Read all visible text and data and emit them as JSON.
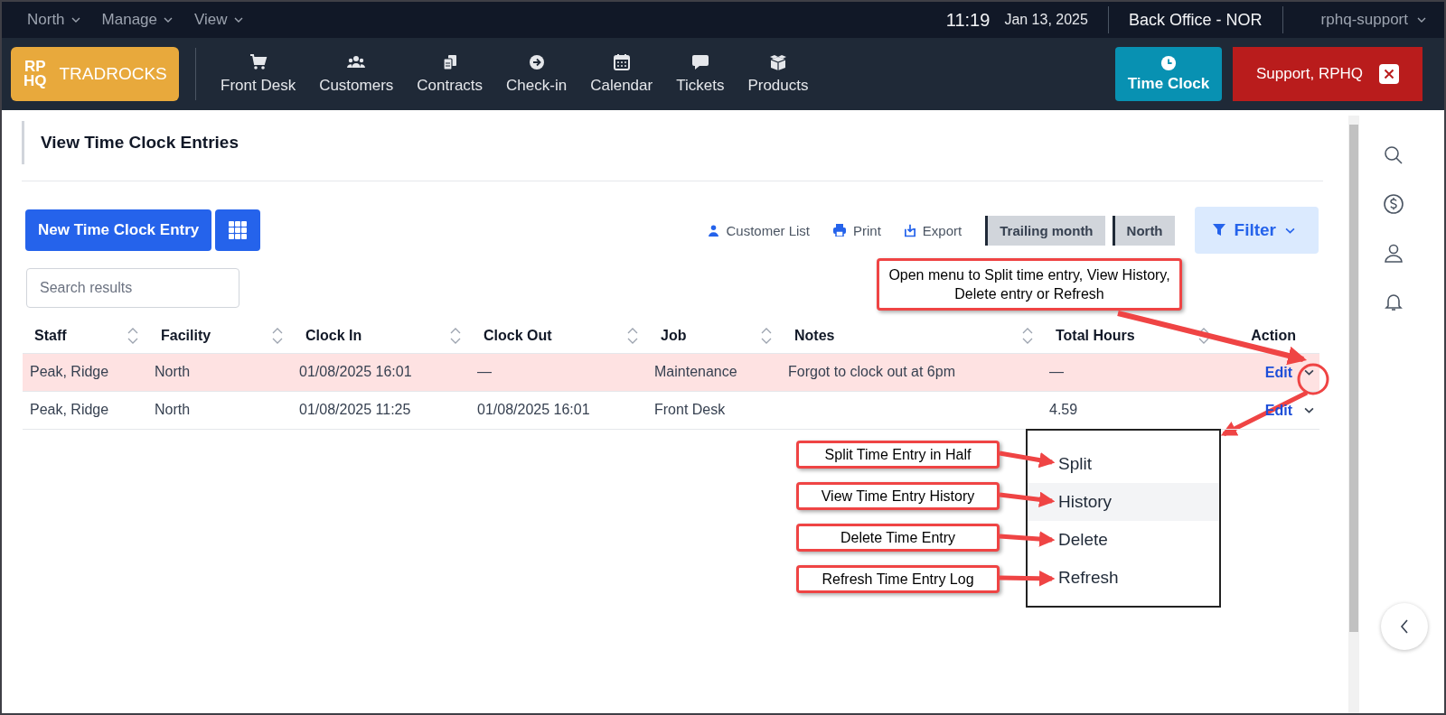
{
  "top_bar": {
    "menus": [
      {
        "label": "North"
      },
      {
        "label": "Manage"
      },
      {
        "label": "View"
      }
    ],
    "time": "11:19",
    "date": "Jan 13, 2025",
    "location": "Back Office - NOR",
    "user": "rphq-support"
  },
  "nav": {
    "logo_mark_top": "RP",
    "logo_mark_bottom": "HQ",
    "logo_text": "TRADROCKS",
    "items": [
      {
        "kind": "cart",
        "label": "Front Desk"
      },
      {
        "kind": "users",
        "label": "Customers"
      },
      {
        "kind": "docs",
        "label": "Contracts"
      },
      {
        "kind": "checkin",
        "label": "Check-in"
      },
      {
        "kind": "calendar",
        "label": "Calendar"
      },
      {
        "kind": "chat",
        "label": "Tickets"
      },
      {
        "kind": "box",
        "label": "Products"
      }
    ],
    "time_clock": "Time Clock",
    "support": "Support, RPHQ"
  },
  "page": {
    "title": "View Time Clock Entries",
    "new_button": "New Time Clock Entry",
    "toolbar_links": [
      {
        "kind": "person",
        "label": "Customer List"
      },
      {
        "kind": "print",
        "label": "Print"
      },
      {
        "kind": "export",
        "label": "Export"
      }
    ],
    "tags": [
      "Trailing month",
      "North"
    ],
    "filter": "Filter",
    "search": {
      "placeholder": "Search results"
    }
  },
  "table": {
    "columns": [
      {
        "label": "Staff",
        "sortable": true
      },
      {
        "label": "Facility",
        "sortable": true
      },
      {
        "label": "Clock In",
        "sortable": true
      },
      {
        "label": "Clock Out",
        "sortable": true
      },
      {
        "label": "Job",
        "sortable": true
      },
      {
        "label": "Notes",
        "sortable": true
      },
      {
        "label": "Total Hours",
        "sortable": true
      },
      {
        "label": "Action",
        "sortable": false
      }
    ],
    "rows": [
      {
        "flagged": true,
        "cells": [
          "Peak, Ridge",
          "North",
          "01/08/2025 16:01",
          "—",
          "Maintenance",
          "Forgot to clock out at 6pm",
          "—"
        ],
        "action": "Edit"
      },
      {
        "flagged": false,
        "cells": [
          "Peak, Ridge",
          "North",
          "01/08/2025 11:25",
          "01/08/2025 16:01",
          "Front Desk",
          "",
          "4.59"
        ],
        "action": "Edit"
      }
    ]
  },
  "action_menu": {
    "items": [
      {
        "label": "Split",
        "selected": false
      },
      {
        "label": "History",
        "selected": true
      },
      {
        "label": "Delete",
        "selected": false
      },
      {
        "label": "Refresh",
        "selected": false
      }
    ]
  },
  "annotations": {
    "main": "Open menu to Split time entry, View History, Delete entry or Refresh",
    "items": [
      "Split Time Entry in Half",
      "View Time Entry History",
      "Delete Time Entry",
      "Refresh Time Entry Log"
    ]
  }
}
